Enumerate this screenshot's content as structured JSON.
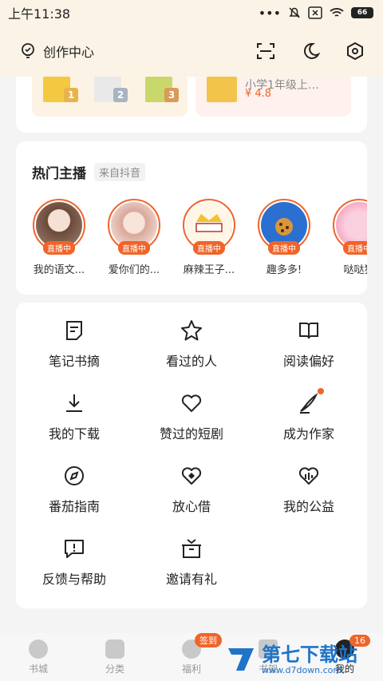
{
  "status_bar": {
    "time": "上午11:38",
    "battery": "66",
    "icons": [
      "dots-icon",
      "bell-muted-icon",
      "sim-off-icon",
      "wifi-icon"
    ]
  },
  "header": {
    "creator_label": "创作中心",
    "icons": [
      "scan-icon",
      "moon-icon",
      "settings-icon"
    ]
  },
  "top_books": {
    "ranks": [
      "1",
      "2",
      "3"
    ],
    "right_title_snippet": "小学1年级上…",
    "right_rating": "¥ 4.8"
  },
  "hot_hosts": {
    "title": "热门主播",
    "source_tag": "来自抖音",
    "live_label": "直播中",
    "hosts": [
      {
        "name": "我的语文..."
      },
      {
        "name": "爱你们的..."
      },
      {
        "name": "麻辣王子..."
      },
      {
        "name": "趣多多!"
      },
      {
        "name": "哒哒猫"
      }
    ]
  },
  "menu": {
    "items": [
      {
        "label": "笔记书摘",
        "icon": "note-icon"
      },
      {
        "label": "看过的人",
        "icon": "star-icon"
      },
      {
        "label": "阅读偏好",
        "icon": "book-open-icon"
      },
      {
        "label": "我的下载",
        "icon": "download-icon"
      },
      {
        "label": "赞过的短剧",
        "icon": "heart-icon"
      },
      {
        "label": "成为作家",
        "icon": "pen-icon"
      },
      {
        "label": "番茄指南",
        "icon": "compass-icon"
      },
      {
        "label": "放心借",
        "icon": "heart-diamond-icon"
      },
      {
        "label": "我的公益",
        "icon": "charity-icon"
      },
      {
        "label": "反馈与帮助",
        "icon": "feedback-icon"
      },
      {
        "label": "邀请有礼",
        "icon": "gift-icon"
      }
    ]
  },
  "bottom_nav": {
    "items": [
      {
        "label": "书城"
      },
      {
        "label": "分类"
      },
      {
        "label": "福利",
        "badge": "签到"
      },
      {
        "label": "书架"
      },
      {
        "label": "我的",
        "badge": "16"
      }
    ]
  },
  "watermark": {
    "text": "第七下载站",
    "url": "www.d7down.com"
  },
  "colors": {
    "accent": "#f0642a",
    "header_bg": "#fbf3e6",
    "watermark": "#1f74c9"
  }
}
